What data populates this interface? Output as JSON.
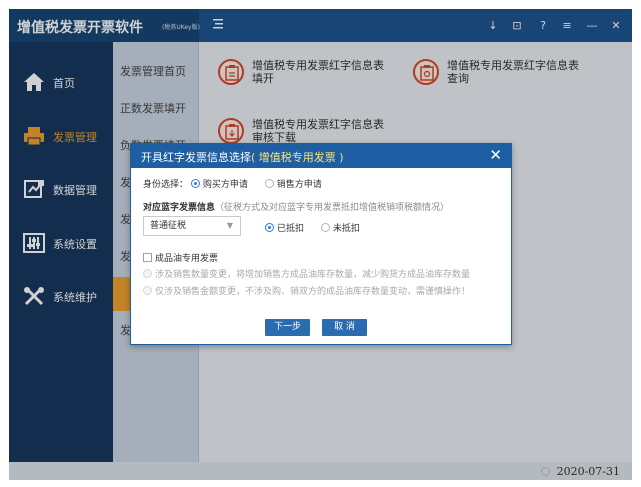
{
  "app": {
    "title": "增值税发票开票软件",
    "subtitle": "(税务UKey版)",
    "toolbar_icons": [
      "download-icon",
      "window-icon",
      "help-icon",
      "menu-icon",
      "minimize-icon",
      "close-icon"
    ],
    "toolbar_glyphs": [
      "↓",
      "⊡",
      "?",
      "≡",
      "—",
      "✕"
    ]
  },
  "sidebar": {
    "items": [
      {
        "label": "首页",
        "icon": "home-icon"
      },
      {
        "label": "发票管理",
        "icon": "invoice-printer-icon",
        "active": true
      },
      {
        "label": "数据管理",
        "icon": "data-icon"
      },
      {
        "label": "系统设置",
        "icon": "settings-sliders-icon"
      },
      {
        "label": "系统维护",
        "icon": "tools-icon"
      }
    ]
  },
  "submenu": {
    "items": [
      {
        "label": "发票管理首页"
      },
      {
        "label": "正数发票填开"
      },
      {
        "label": "负数发票填开"
      },
      {
        "label": "发"
      },
      {
        "label": "发"
      },
      {
        "label": "发"
      },
      {
        "label": "",
        "active": true
      },
      {
        "label": "发"
      }
    ]
  },
  "main": {
    "cards": [
      {
        "label": "增值税专用发票红字信息表填开"
      },
      {
        "label": "增值税专用发票红字信息表查询"
      },
      {
        "label": "增值税专用发票红字信息表审核下载"
      }
    ]
  },
  "dialog": {
    "title": "开具红字发票信息选择",
    "title_highlight": "( 增值税专用发票 )",
    "identity_label": "身份选择：",
    "identity_options": [
      "购买方申请",
      "销售方申请"
    ],
    "blue_invoice_label": "对应蓝字发票信息",
    "blue_invoice_hint": "（征税方式及对应蓝字专用发票抵扣增值税销项税额情况）",
    "tax_method": "普通征税",
    "deduct_options": [
      "已抵扣",
      "未抵扣"
    ],
    "oil_label": "成品油专用发票",
    "oil_options": [
      "涉及销售数量变更，将增加销售方成品油库存数量，减少购货方成品油库存数量",
      "仅涉及销售金额变更，不涉及购、销双方的成品油库存数量变动，需谨慎操作！"
    ],
    "next_button": "下一步",
    "cancel_button": "取 消"
  },
  "statusbar": {
    "date": "2020-07-31"
  },
  "colors": {
    "topbar": "#1e5491",
    "sidebar": "#16375f",
    "accent": "#f0a030",
    "dialog_header": "#1e5fa3",
    "button": "#2b6bb0"
  }
}
